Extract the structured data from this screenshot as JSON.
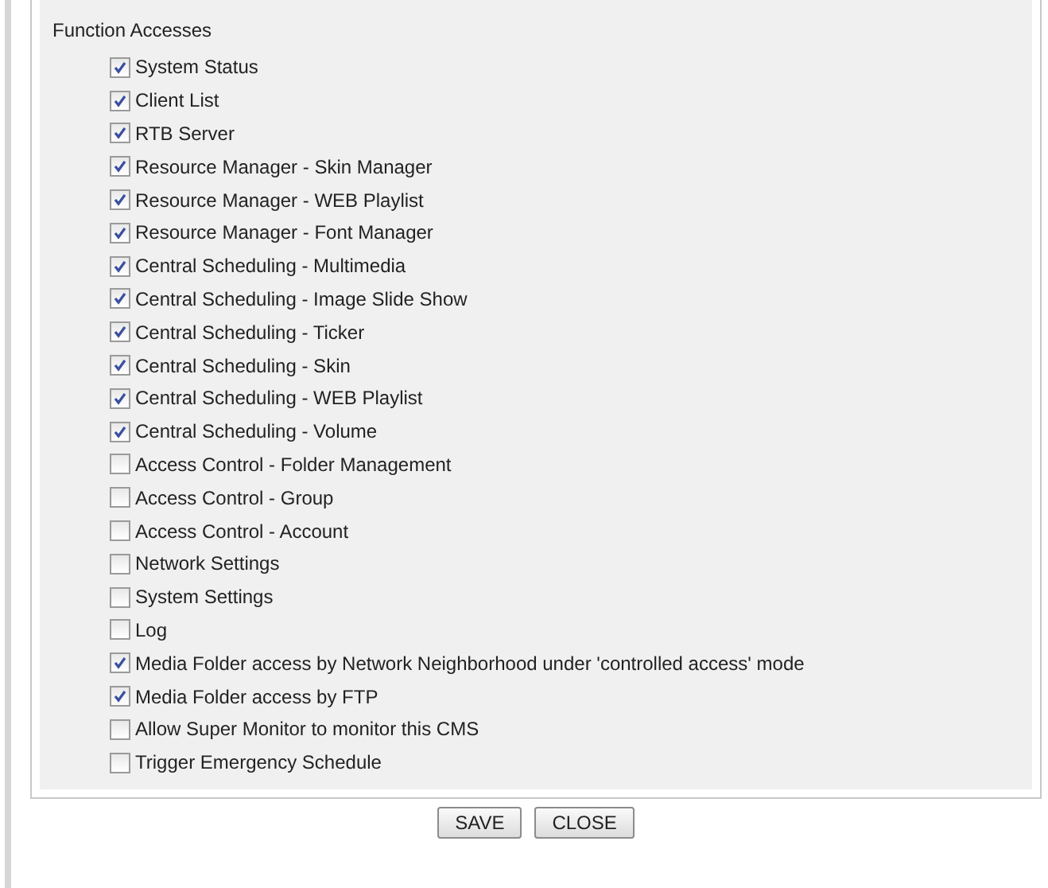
{
  "section": {
    "title": "Function Accesses"
  },
  "options": [
    {
      "label": "System Status",
      "checked": true
    },
    {
      "label": "Client List",
      "checked": true
    },
    {
      "label": "RTB Server",
      "checked": true
    },
    {
      "label": "Resource Manager - Skin Manager",
      "checked": true
    },
    {
      "label": "Resource Manager - WEB Playlist",
      "checked": true
    },
    {
      "label": "Resource Manager - Font Manager",
      "checked": true
    },
    {
      "label": "Central Scheduling - Multimedia",
      "checked": true
    },
    {
      "label": "Central Scheduling - Image Slide Show",
      "checked": true
    },
    {
      "label": "Central Scheduling - Ticker",
      "checked": true
    },
    {
      "label": "Central Scheduling - Skin",
      "checked": true
    },
    {
      "label": "Central Scheduling - WEB Playlist",
      "checked": true
    },
    {
      "label": "Central Scheduling - Volume",
      "checked": true
    },
    {
      "label": "Access Control - Folder Management",
      "checked": false
    },
    {
      "label": "Access Control - Group",
      "checked": false
    },
    {
      "label": "Access Control - Account",
      "checked": false
    },
    {
      "label": "Network Settings",
      "checked": false
    },
    {
      "label": "System Settings",
      "checked": false
    },
    {
      "label": "Log",
      "checked": false
    },
    {
      "label": "Media Folder access by Network Neighborhood under 'controlled access' mode",
      "checked": true
    },
    {
      "label": "Media Folder access by FTP",
      "checked": true
    },
    {
      "label": "Allow Super Monitor to monitor this CMS",
      "checked": false
    },
    {
      "label": "Trigger Emergency Schedule",
      "checked": false
    }
  ],
  "buttons": [
    {
      "label": "SAVE"
    },
    {
      "label": "CLOSE"
    }
  ]
}
